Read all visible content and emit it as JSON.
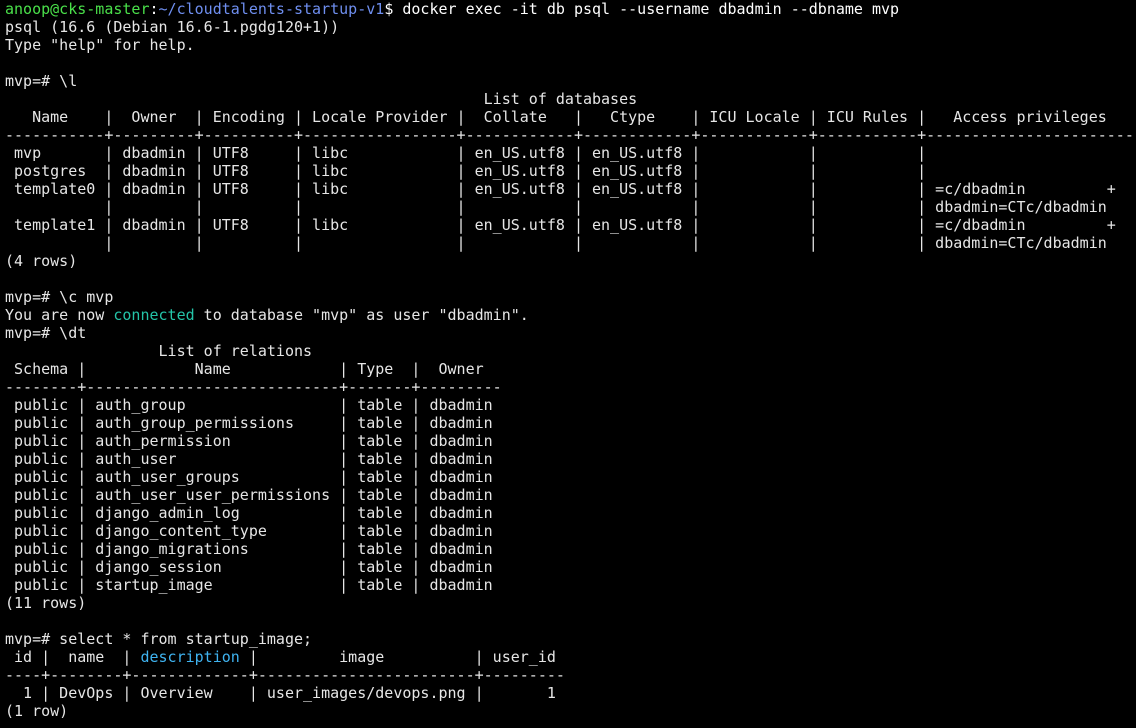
{
  "colors": {
    "background": "#000000",
    "foreground": "#e6e6e6",
    "prompt_user": "#4ae04a",
    "prompt_path": "#6f8ff0",
    "highlight_connected": "#24c4a8",
    "highlight_description": "#3fb3f0"
  },
  "terminal": {
    "lines": [
      [
        {
          "t": "anoop@cks-master",
          "c": "c-green"
        },
        {
          "t": ":",
          "c": "c-white"
        },
        {
          "t": "~/cloudtalents-startup-v1",
          "c": "c-blue"
        },
        {
          "t": "$ docker exec -it db psql --username dbadmin --dbname mvp",
          "c": "c-white"
        }
      ],
      [
        {
          "t": "psql (16.6 (Debian 16.6-1.pgdg120+1))"
        }
      ],
      [
        {
          "t": "Type \"help\" for help."
        }
      ],
      [
        {
          "t": ""
        }
      ],
      [
        {
          "t": "mvp=# \\l"
        }
      ],
      [
        {
          "t": "                                                     List of databases"
        }
      ],
      [
        {
          "t": "   Name    |  Owner  | Encoding | Locale Provider |  Collate   |   Ctype    | ICU Locale | ICU Rules |   Access privileges"
        }
      ],
      [
        {
          "t": "-----------+---------+----------+-----------------+------------+------------+------------+-----------+-----------------------"
        }
      ],
      [
        {
          "t": " mvp       | dbadmin | UTF8     | libc            | en_US.utf8 | en_US.utf8 |            |           |"
        }
      ],
      [
        {
          "t": " postgres  | dbadmin | UTF8     | libc            | en_US.utf8 | en_US.utf8 |            |           |"
        }
      ],
      [
        {
          "t": " template0 | dbadmin | UTF8     | libc            | en_US.utf8 | en_US.utf8 |            |           | =c/dbadmin         +"
        }
      ],
      [
        {
          "t": "           |         |          |                 |            |            |            |           | dbadmin=CTc/dbadmin"
        }
      ],
      [
        {
          "t": " template1 | dbadmin | UTF8     | libc            | en_US.utf8 | en_US.utf8 |            |           | =c/dbadmin         +"
        }
      ],
      [
        {
          "t": "           |         |          |                 |            |            |            |           | dbadmin=CTc/dbadmin"
        }
      ],
      [
        {
          "t": "(4 rows)"
        }
      ],
      [
        {
          "t": ""
        }
      ],
      [
        {
          "t": "mvp=# \\c mvp"
        }
      ],
      [
        {
          "t": "You are now "
        },
        {
          "t": "connected",
          "c": "c-cyan"
        },
        {
          "t": " to database \"mvp\" as user \"dbadmin\"."
        }
      ],
      [
        {
          "t": "mvp=# \\dt"
        }
      ],
      [
        {
          "t": "                 List of relations"
        }
      ],
      [
        {
          "t": " Schema |            Name            | Type  |  Owner"
        }
      ],
      [
        {
          "t": "--------+----------------------------+-------+---------"
        }
      ],
      [
        {
          "t": " public | auth_group                 | table | dbadmin"
        }
      ],
      [
        {
          "t": " public | auth_group_permissions     | table | dbadmin"
        }
      ],
      [
        {
          "t": " public | auth_permission            | table | dbadmin"
        }
      ],
      [
        {
          "t": " public | auth_user                  | table | dbadmin"
        }
      ],
      [
        {
          "t": " public | auth_user_groups           | table | dbadmin"
        }
      ],
      [
        {
          "t": " public | auth_user_user_permissions | table | dbadmin"
        }
      ],
      [
        {
          "t": " public | django_admin_log           | table | dbadmin"
        }
      ],
      [
        {
          "t": " public | django_content_type        | table | dbadmin"
        }
      ],
      [
        {
          "t": " public | django_migrations          | table | dbadmin"
        }
      ],
      [
        {
          "t": " public | django_session             | table | dbadmin"
        }
      ],
      [
        {
          "t": " public | startup_image              | table | dbadmin"
        }
      ],
      [
        {
          "t": "(11 rows)"
        }
      ],
      [
        {
          "t": ""
        }
      ],
      [
        {
          "t": "mvp=# select * from startup_image;"
        }
      ],
      [
        {
          "t": " id |  name  | "
        },
        {
          "t": "description",
          "c": "c-ltblue"
        },
        {
          "t": " |         image          | user_id"
        }
      ],
      [
        {
          "t": "----+--------+-------------+------------------------+---------"
        }
      ],
      [
        {
          "t": "  1 | DevOps | Overview    | user_images/devops.png |       1"
        }
      ],
      [
        {
          "t": "(1 row)"
        }
      ]
    ]
  }
}
